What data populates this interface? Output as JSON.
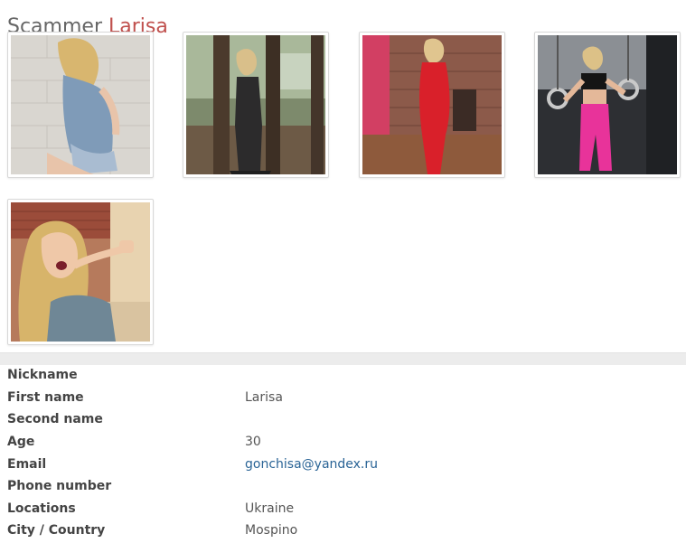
{
  "header": {
    "title_prefix": "Scammer",
    "title_name": "Larisa"
  },
  "gallery": {
    "photos": [
      {
        "subject": "woman in denim vest against brick wall"
      },
      {
        "subject": "woman standing between trees"
      },
      {
        "subject": "woman in red dress in bar room"
      },
      {
        "subject": "woman in pink leggings at gym rings"
      },
      {
        "subject": "woman eating from a spoon"
      }
    ]
  },
  "profile": {
    "rows": [
      {
        "label": "Nickname",
        "value": ""
      },
      {
        "label": "First name",
        "value": "Larisa"
      },
      {
        "label": "Second name",
        "value": ""
      },
      {
        "label": "Age",
        "value": "30"
      },
      {
        "label": "Email",
        "value": "gonchisa@yandex.ru"
      },
      {
        "label": "Phone number",
        "value": ""
      },
      {
        "label": "Locations",
        "value": "Ukraine"
      },
      {
        "label": "City / Country",
        "value": "Mospino"
      }
    ]
  },
  "colors": {
    "name_accent": "#c0504d",
    "link": "#2a6496"
  }
}
